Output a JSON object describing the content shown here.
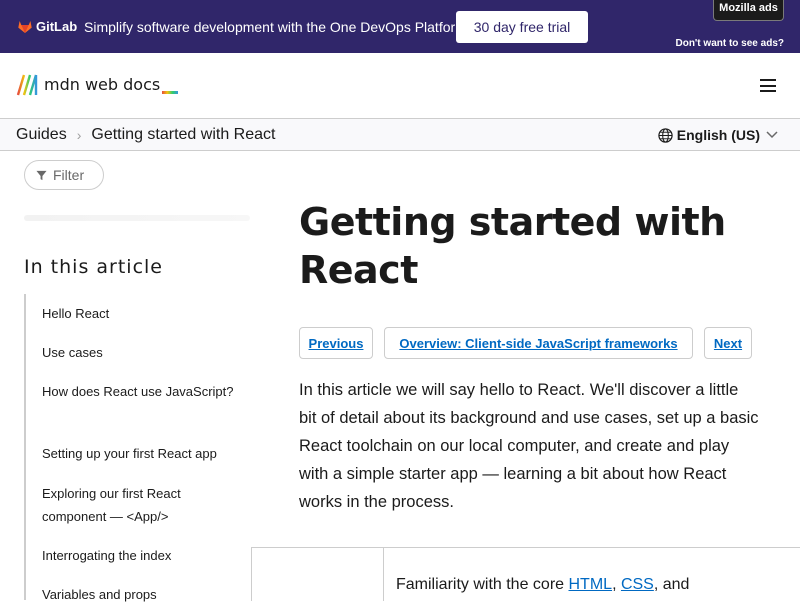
{
  "ad": {
    "brand": "GitLab",
    "message": "Simplify software development with the One DevOps Platform.",
    "cta": "30 day free trial",
    "sponsor_label": "Mozilla ads",
    "dismiss": "Don't want to see ads?",
    "background_color": "#30266a"
  },
  "header": {
    "logo_text": "mdn web docs",
    "menu_icon": "hamburger-icon"
  },
  "breadcrumb": {
    "items": [
      "Guides",
      "Getting started with React"
    ],
    "language": "English (US)"
  },
  "sidebar": {
    "filter_placeholder": "Filter",
    "toc_title": "In this article",
    "toc_items": [
      "Hello React",
      "Use cases",
      "How does React use JavaScript?",
      "Setting up your first React app",
      "Exploring our first React component — <App/>",
      "Interrogating the index",
      "Variables and props"
    ]
  },
  "main": {
    "title": "Getting started with React",
    "nav": {
      "previous": "Previous",
      "overview": "Overview: Client-side JavaScript frameworks",
      "next": "Next"
    },
    "intro": "In this article we will say hello to React. We'll discover a little bit of detail about its background and use cases, set up a basic React toolchain on our local computer, and create and play with a simple starter app — learning a bit about how React works in the process.",
    "prereq": {
      "text_before": "Familiarity with the core ",
      "link1": "HTML",
      "sep": ", ",
      "link2": "CSS",
      "text_after": ", and"
    }
  },
  "colors": {
    "link": "#0069c2",
    "text": "#1b1b1b",
    "border": "#cdcdcd"
  }
}
